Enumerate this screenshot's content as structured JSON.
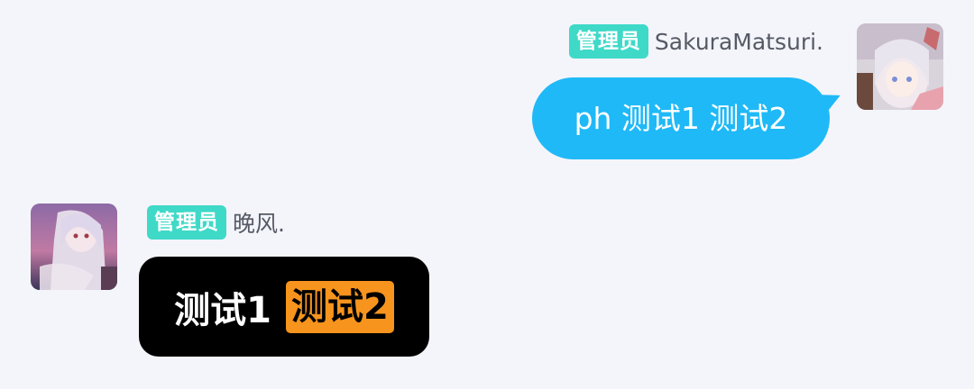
{
  "messages": [
    {
      "side": "right",
      "role_badge": "管理员",
      "sender": "SakuraMatsuri.",
      "avatar_icon": "avatar-sakura",
      "text": "ph 测试1 测试2",
      "bubble_color": "#1fb9f7"
    },
    {
      "side": "left",
      "role_badge": "管理员",
      "sender": "晚风.",
      "avatar_icon": "avatar-wanfeng",
      "logo_text_1": "测试1",
      "logo_text_2": "测试2",
      "bubble_color": "#000000",
      "logo_accent": "#f7941d"
    }
  ],
  "colors": {
    "background": "#f4f5fa",
    "role_badge": "#3fd9c8",
    "nickname": "#555a66"
  }
}
